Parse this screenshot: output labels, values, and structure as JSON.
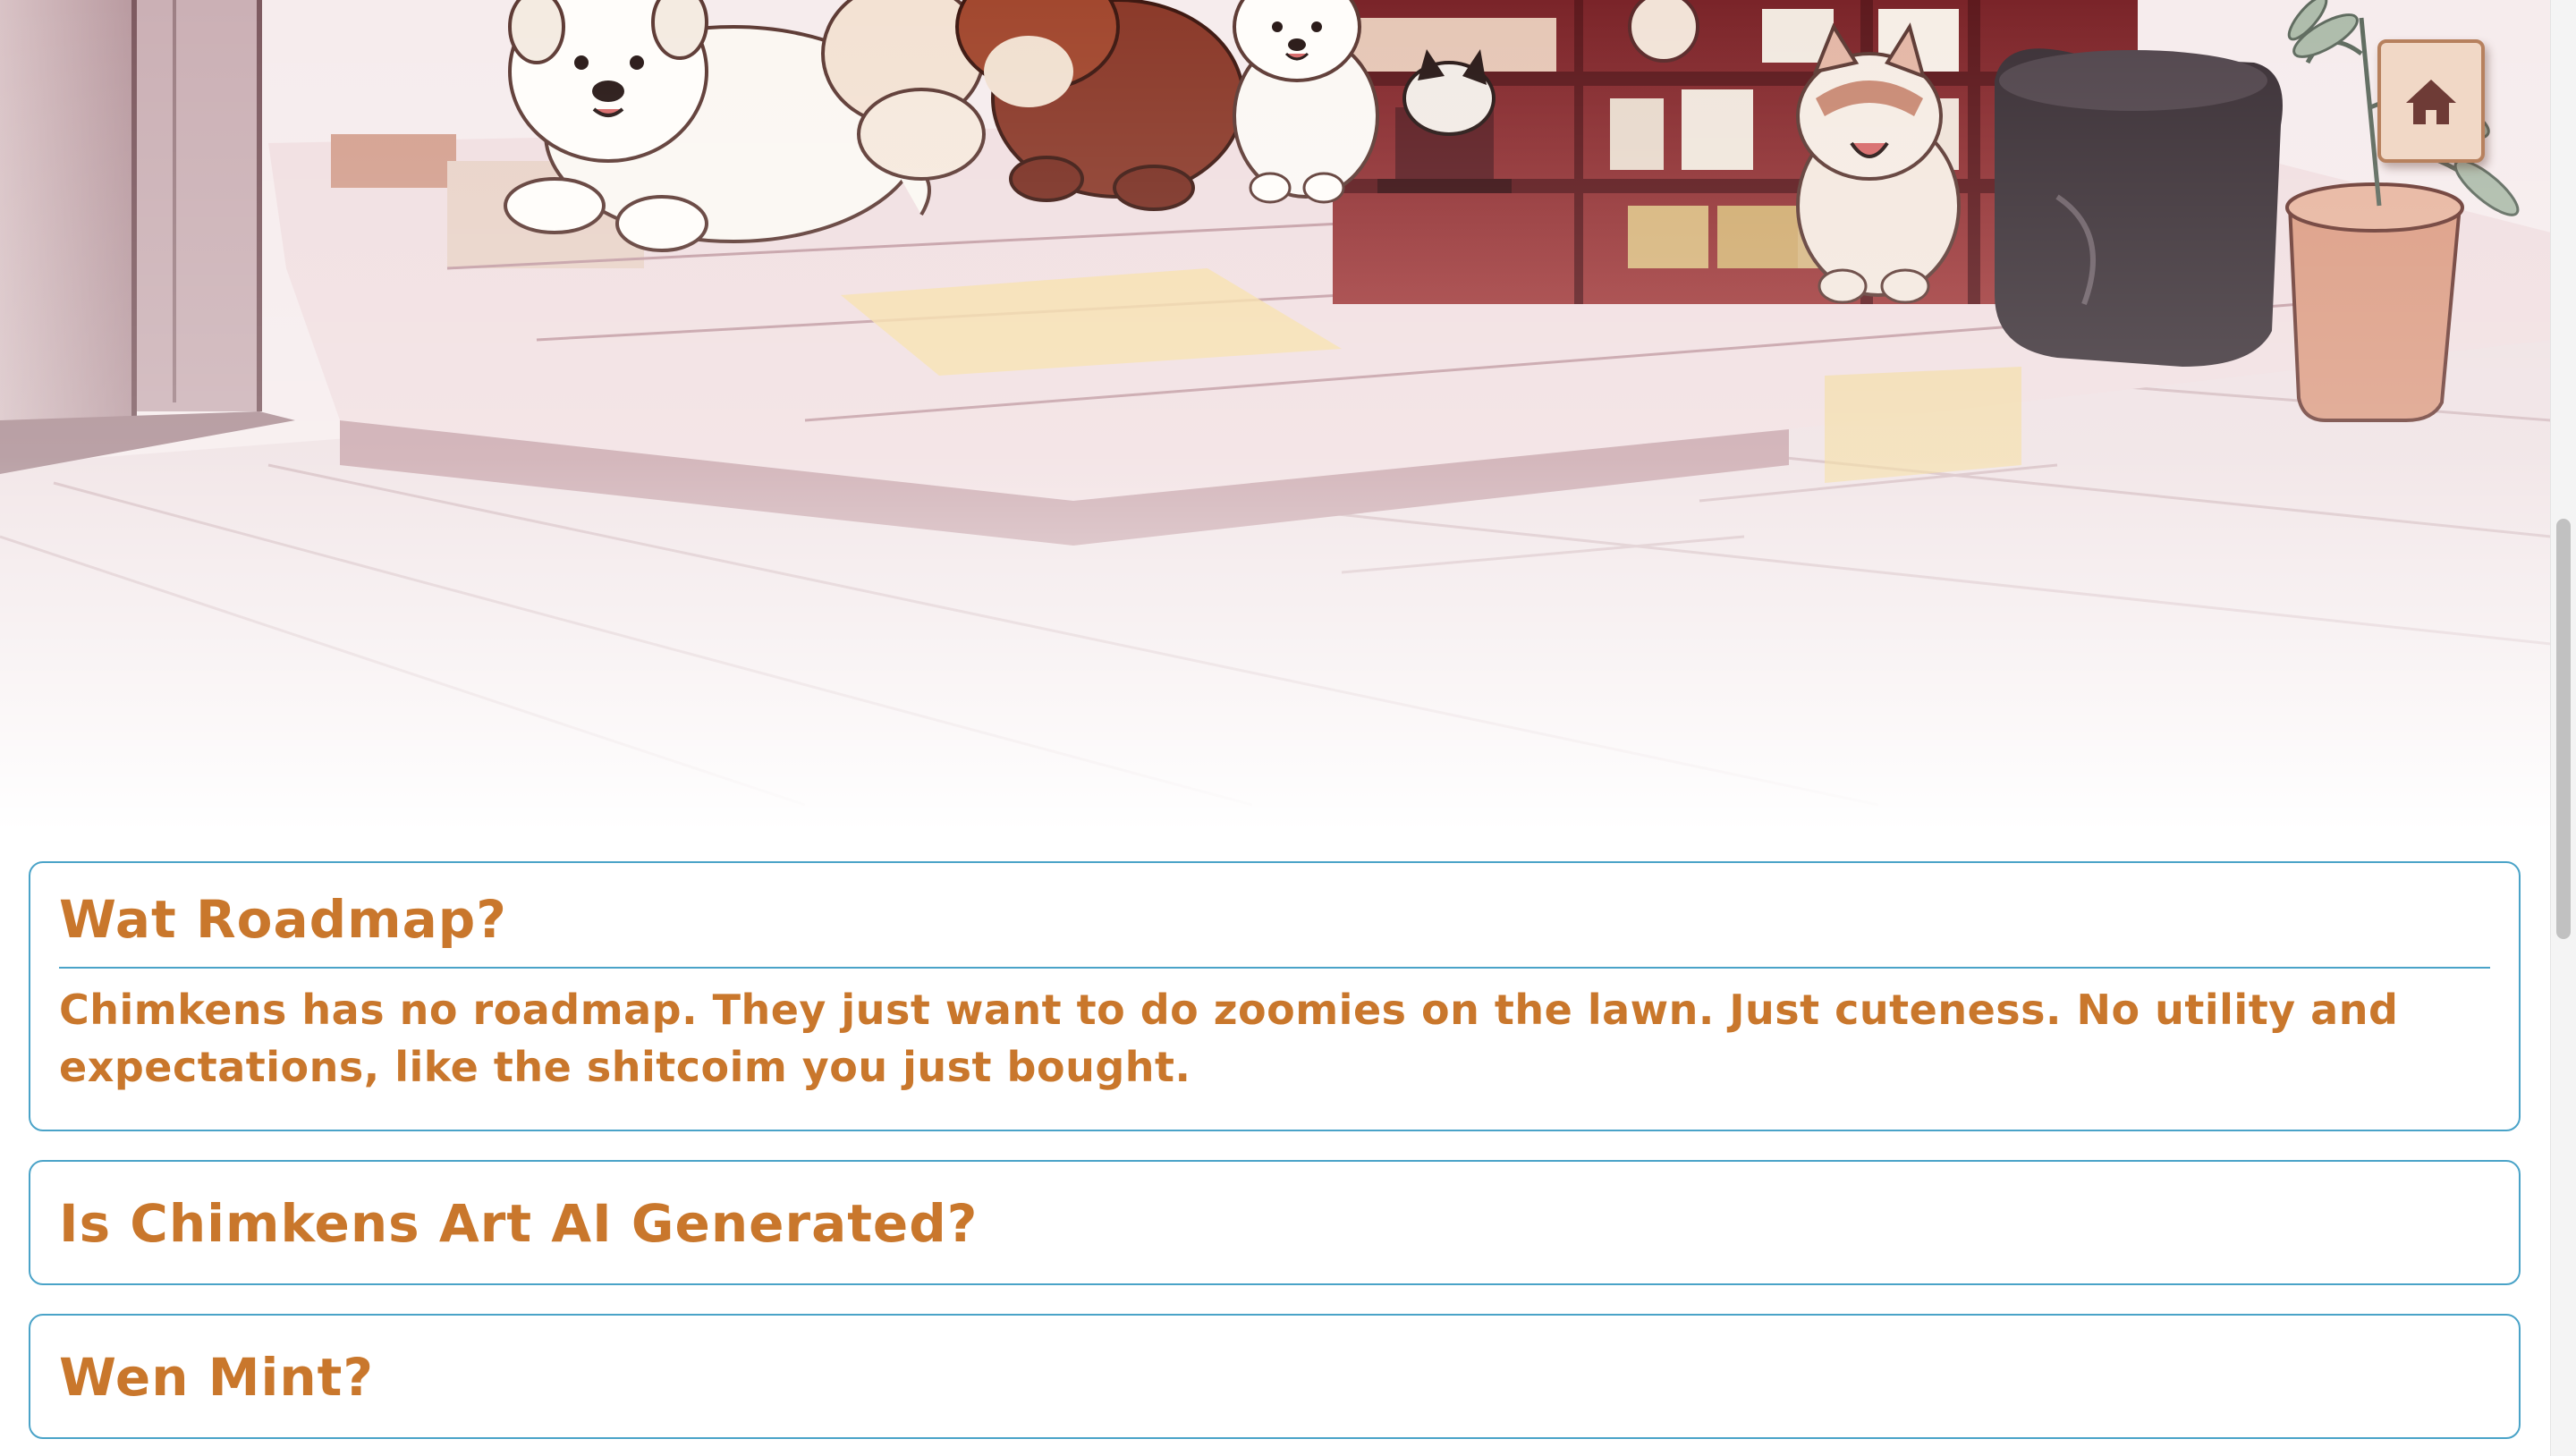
{
  "hero": {
    "image": "dogs-in-shop-illustration"
  },
  "nav": {
    "home_icon": "home-icon"
  },
  "faq": [
    {
      "question": "Wat Roadmap?",
      "answer_line_1": "Chimkens has no roadmap. They just want to do zoomies on the lawn. Just cuteness. No utility and",
      "answer_line_2": "expectations, like the shitcoim you just bought.",
      "expanded": true
    },
    {
      "question": "Is Chimkens Art AI Generated?",
      "expanded": false
    },
    {
      "question": "Wen Mint?",
      "expanded": false
    }
  ],
  "colors": {
    "accent_text": "#c9772c",
    "card_border": "#4aa3c8",
    "illustration_wood": "#8b2f2f",
    "illustration_floor": "#f3e6e6"
  }
}
